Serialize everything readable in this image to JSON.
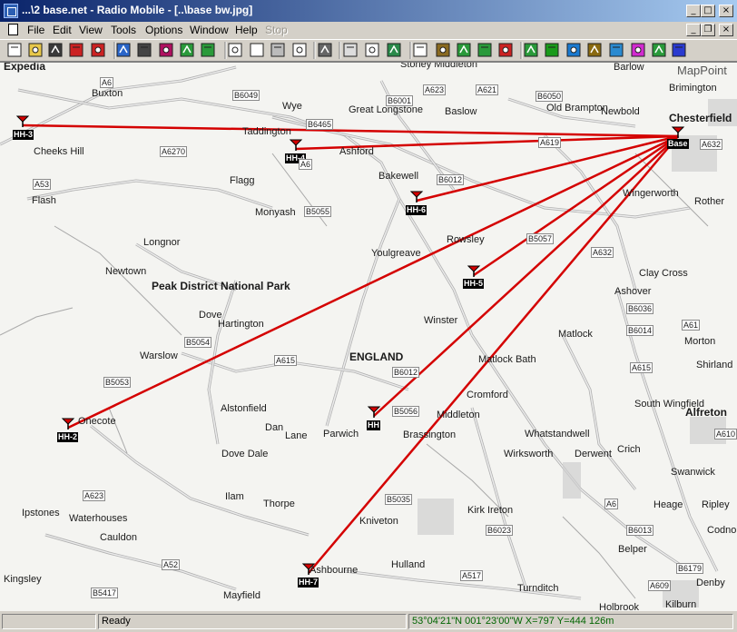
{
  "window": {
    "title": "...\\2 base.net - Radio Mobile - [..\\base bw.jpg]"
  },
  "menu": [
    "File",
    "Edit",
    "View",
    "Tools",
    "Options",
    "Window",
    "Help",
    "Stop"
  ],
  "toolbar_icons": [
    "new-file-icon",
    "open-folder-icon",
    "save-icon",
    "cut-icon",
    "unit-icon",
    "globe-icon",
    "disk-icon",
    "target-icon",
    "arrow-left-icon",
    "arrow-right-icon",
    "window-icon",
    "page-icon",
    "copy-icon",
    "pdf-icon",
    "print-icon",
    "clipboard-icon",
    "paste-icon",
    "map-icon",
    "panel-icon",
    "terrain-icon",
    "grid-dots-icon",
    "grid-small-icon",
    "close-map-icon",
    "antenna-icon",
    "green-circle-icon",
    "earth-icon",
    "hourglass-icon",
    "network-icon",
    "palette-icon",
    "chart-icon",
    "signal-icon"
  ],
  "map": {
    "places": [
      {
        "text": "Expedia"
      },
      {
        "text": "Buxton"
      },
      {
        "text": "Stoney Middleton"
      },
      {
        "text": "Barlow"
      },
      {
        "text": "MapPoint"
      },
      {
        "text": "Brimington"
      },
      {
        "text": "Baslow"
      },
      {
        "text": "Great Longstone"
      },
      {
        "text": "Old Brampton"
      },
      {
        "text": "Newbold"
      },
      {
        "text": "Chesterfield"
      },
      {
        "text": "Taddington"
      },
      {
        "text": "Wye"
      },
      {
        "text": "Cheeks Hill"
      },
      {
        "text": "Ashford"
      },
      {
        "text": "Flash"
      },
      {
        "text": "Flagg"
      },
      {
        "text": "Bakewell"
      },
      {
        "text": "Wingerworth"
      },
      {
        "text": "Monyash"
      },
      {
        "text": "Rother"
      },
      {
        "text": "Longnor"
      },
      {
        "text": "Rowsley"
      },
      {
        "text": "Youlgreave"
      },
      {
        "text": "Newtown"
      },
      {
        "text": "Peak District National Park"
      },
      {
        "text": "Clay Cross"
      },
      {
        "text": "Ashover"
      },
      {
        "text": "Dove"
      },
      {
        "text": "Hartington"
      },
      {
        "text": "Winster"
      },
      {
        "text": "Matlock"
      },
      {
        "text": "Morton"
      },
      {
        "text": "Warslow"
      },
      {
        "text": "ENGLAND"
      },
      {
        "text": "Matlock Bath"
      },
      {
        "text": "Shirland"
      },
      {
        "text": "Cromford"
      },
      {
        "text": "South Wingfield"
      },
      {
        "text": "Alfreton"
      },
      {
        "text": "Alstonfield"
      },
      {
        "text": "Onecote"
      },
      {
        "text": "Middleton"
      },
      {
        "text": "Dan"
      },
      {
        "text": "Lane"
      },
      {
        "text": "Parwich"
      },
      {
        "text": "Brassington"
      },
      {
        "text": "Whatstandwell"
      },
      {
        "text": "Crich"
      },
      {
        "text": "Derwent"
      },
      {
        "text": "Dove Dale"
      },
      {
        "text": "Wirksworth"
      },
      {
        "text": "Swanwick"
      },
      {
        "text": "Ilam"
      },
      {
        "text": "Thorpe"
      },
      {
        "text": "Ipstones"
      },
      {
        "text": "Waterhouses"
      },
      {
        "text": "Kirk Ireton"
      },
      {
        "text": "Heage"
      },
      {
        "text": "Ripley"
      },
      {
        "text": "Cauldon"
      },
      {
        "text": "Kniveton"
      },
      {
        "text": "Codnor"
      },
      {
        "text": "Belper"
      },
      {
        "text": "Ashbourne"
      },
      {
        "text": "Hulland"
      },
      {
        "text": "Kingsley"
      },
      {
        "text": "Mayfield"
      },
      {
        "text": "Turnditch"
      },
      {
        "text": "Denby"
      },
      {
        "text": "Holbrook"
      },
      {
        "text": "Kilburn"
      }
    ],
    "roads": [
      "A6",
      "B6049",
      "A623",
      "A621",
      "B6050",
      "B6001",
      "B6465",
      "A619",
      "A632",
      "A6270",
      "A6",
      "A53",
      "B6012",
      "B5055",
      "B5057",
      "A632",
      "B6036",
      "B6014",
      "A61",
      "B5054",
      "A615",
      "B6012",
      "B5053",
      "A615",
      "B5056",
      "A610",
      "A623",
      "B5035",
      "B6023",
      "A6",
      "B6013",
      "A52",
      "A517",
      "B6179",
      "B5417",
      "A609"
    ],
    "stations": [
      {
        "label": "HH-3"
      },
      {
        "label": "HH-4"
      },
      {
        "label": "Base"
      },
      {
        "label": "HH-6"
      },
      {
        "label": "HH-5"
      },
      {
        "label": "HH-2"
      },
      {
        "label": "HH"
      },
      {
        "label": "HH-7"
      }
    ]
  },
  "status": {
    "state": "Ready",
    "coords": "53°04'21\"N 001°23'00\"W  X=797 Y=444 126m"
  }
}
